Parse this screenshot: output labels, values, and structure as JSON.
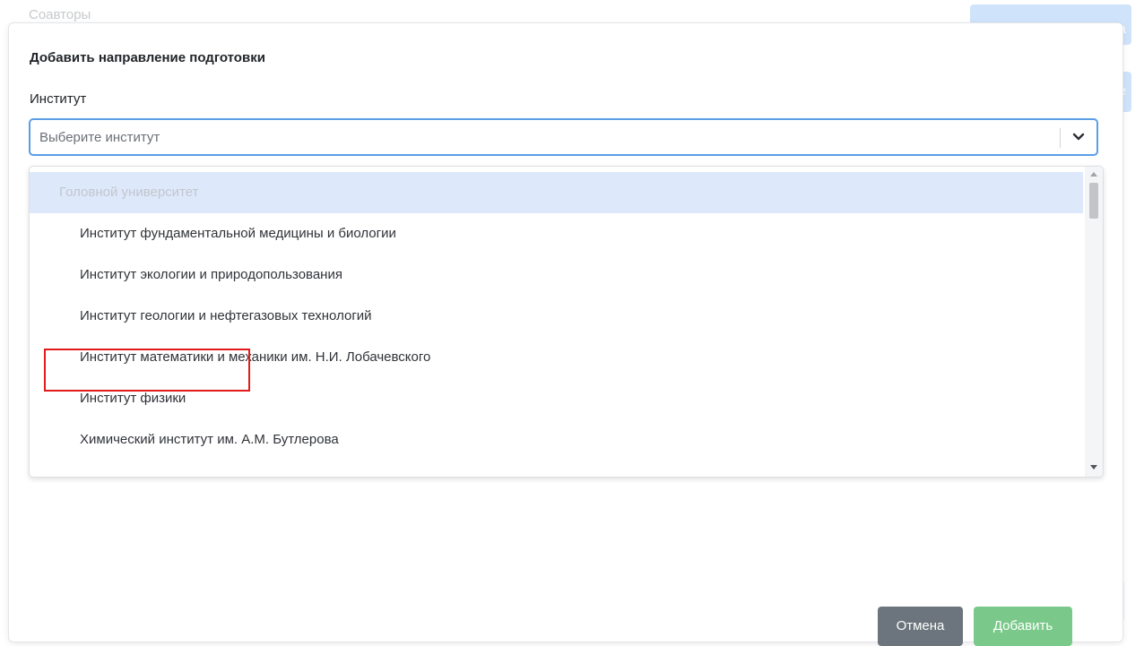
{
  "background": {
    "coauthors_label": "Соавторы",
    "button_1_fragment": "а",
    "button_2_fragment": "е"
  },
  "modal": {
    "title": "Добавить направление подготовки",
    "institute_label": "Институт",
    "select_placeholder": "Выберите институт",
    "dropdown": {
      "group_label": "Головной университет",
      "options": [
        "Институт фундаментальной медицины и биологии",
        "Институт экологии и природопользования",
        "Институт геологии и нефтегазовых технологий",
        "Институт математики и механики им. Н.И. Лобачевского",
        "Институт физики",
        "Химический институт им. А.М. Бутлерова"
      ],
      "highlighted_option": "Институт физики"
    },
    "cancel_label": "Отмена",
    "add_label": "Добавить"
  },
  "icons": {
    "select_chevron": "chevron-down-icon",
    "scroll_up": "scroll-up-arrow-icon",
    "scroll_down": "scroll-down-arrow-icon"
  },
  "colors": {
    "focus_border": "#5b9ee6",
    "group_bg": "#dde9fb",
    "highlight_border": "#e21b1b",
    "cancel_button": "#6c757d",
    "add_button": "#7ac98a"
  }
}
